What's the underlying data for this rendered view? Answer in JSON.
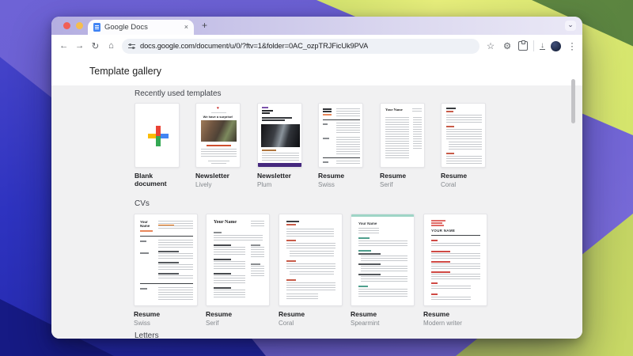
{
  "browser": {
    "tab_title": "Google Docs",
    "url": "docs.google.com/document/u/0/?ftv=1&folder=0AC_ozpTRJFicUk9PVA"
  },
  "page": {
    "title": "Template gallery"
  },
  "icons": {
    "back": "←",
    "forward": "→",
    "reload": "↻",
    "home": "⌂",
    "star": "☆",
    "gear": "⚙",
    "kebab": "⋮",
    "chevron": "⌄",
    "close": "×",
    "new_tab": "+",
    "heart": "♥",
    "download": "↓"
  },
  "sections": {
    "recent": {
      "label": "Recently used templates",
      "items": [
        {
          "title": "Blank document",
          "subtitle": ""
        },
        {
          "title": "Newsletter",
          "subtitle": "Lively"
        },
        {
          "title": "Newsletter",
          "subtitle": "Plum"
        },
        {
          "title": "Resume",
          "subtitle": "Swiss"
        },
        {
          "title": "Resume",
          "subtitle": "Serif"
        },
        {
          "title": "Resume",
          "subtitle": "Coral"
        }
      ]
    },
    "cvs": {
      "label": "CVs",
      "items": [
        {
          "title": "Resume",
          "subtitle": "Swiss"
        },
        {
          "title": "Resume",
          "subtitle": "Serif"
        },
        {
          "title": "Resume",
          "subtitle": "Coral"
        },
        {
          "title": "Resume",
          "subtitle": "Spearmint"
        },
        {
          "title": "Resume",
          "subtitle": "Modern writer"
        }
      ]
    },
    "letters": {
      "label": "Letters"
    }
  },
  "thumbs": {
    "lively_headline": "We have a surprise!",
    "your_name": "Your Name",
    "your_name_caps": "YOUR NAME"
  },
  "colors": {
    "docs_blue": "#4285f4",
    "plus_red": "#ea4335",
    "plus_yellow": "#fbbc04",
    "plus_blue": "#4285f4",
    "plus_green": "#34a853",
    "plum_bar": "#45287e",
    "swiss_accent": "#e8710a",
    "coral_accent": "#c85c49",
    "spearmint_accent": "#9ed5c6",
    "modern_writer_accent": "#cf4944"
  }
}
